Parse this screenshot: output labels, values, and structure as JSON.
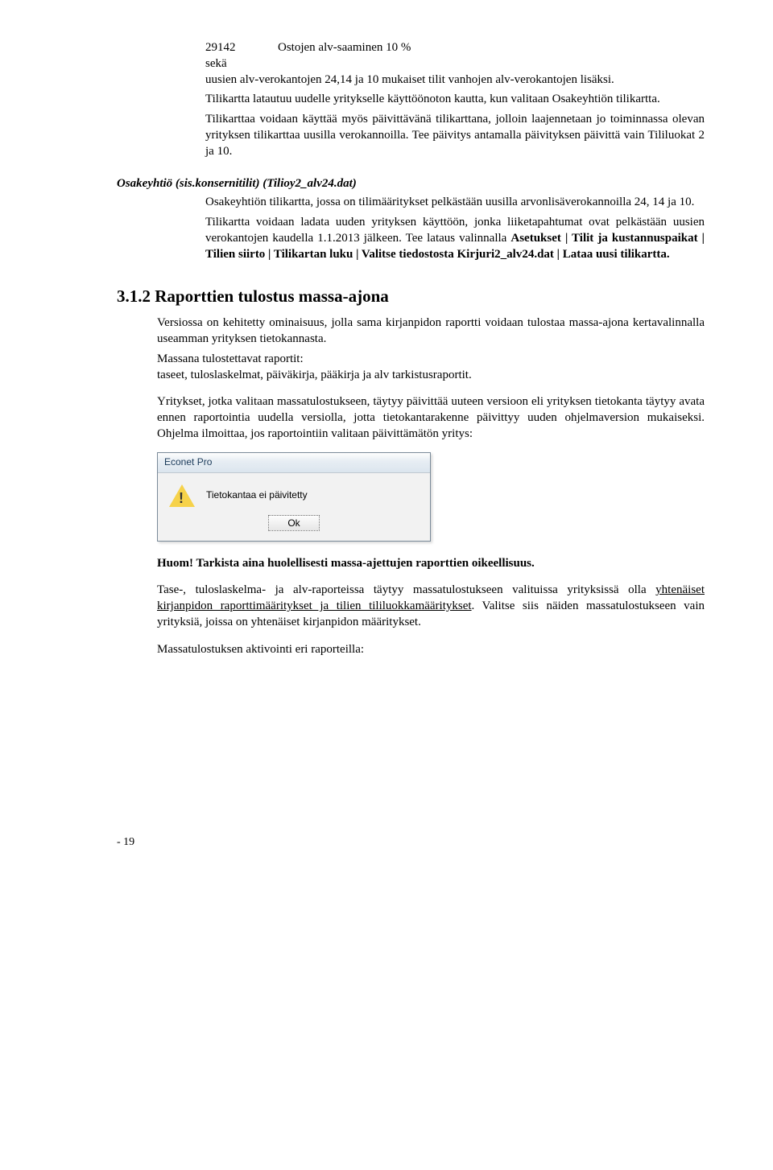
{
  "top": {
    "tili_code": "29142",
    "tili_name": "Ostojen alv-saaminen 10 %",
    "seka": "sekä",
    "p1": "uusien alv-verokantojen 24,14 ja 10 mukaiset tilit vanhojen alv-verokantojen lisäksi.",
    "p2": "Tilikartta latautuu uudelle yritykselle käyttöönoton kautta, kun valitaan Osakeyhtiön tilikartta.",
    "p3": "Tilikarttaa voidaan käyttää myös päivittävänä tilikarttana, jolloin laajennetaan jo toiminnassa olevan yrityksen tilikarttaa uusilla verokannoilla. Tee päivitys antamalla päivityksen päivittä vain Tililuokat 2 ja 10."
  },
  "osake": {
    "head": "Osakeyhtiö (sis.konsernitilit) (Tilioy2_alv24.dat)",
    "p1": "Osakeyhtiön tilikartta, jossa on tilimääritykset pelkästään uusilla arvonlisäverokannoilla 24, 14 ja 10.",
    "p2a": "Tilikartta voidaan ladata uuden yrityksen käyttöön, jonka liiketapahtumat ovat pelkästään uusien verokantojen kaudella 1.1.2013 jälkeen. Tee lataus valinnalla ",
    "p2b": "Asetukset | Tilit ja kustannuspaikat | Tilien siirto | Tilikartan luku | Valitse tiedostosta Kirjuri2_alv24.dat | Lataa uusi tilikartta."
  },
  "section": {
    "num": "3.1.2",
    "title": "Raporttien tulostus massa-ajona",
    "p1": "Versiossa on kehitetty ominaisuus, jolla sama kirjanpidon raportti voidaan tulostaa massa-ajona kertavalinnalla useamman yrityksen tietokannasta.",
    "p2": "Massana tulostettavat raportit:",
    "p3": "taseet, tuloslaskelmat, päiväkirja, pääkirja ja alv tarkistusraportit.",
    "p4": "Yritykset, jotka valitaan massatulostukseen, täytyy päivittää uuteen versioon eli yrityksen tietokanta täytyy avata ennen raportointia uudella versiolla, jotta tietokantarakenne päivittyy uuden ohjelmaversion mukaiseksi. Ohjelma ilmoittaa, jos raportointiin valitaan päivittämätön yritys:"
  },
  "dialog": {
    "title": "Econet Pro",
    "msg": "Tietokantaa ei päivitetty",
    "ok": "Ok"
  },
  "after": {
    "p1": "Huom! Tarkista aina huolellisesti massa-ajettujen raporttien oikeellisuus.",
    "p2a": "Tase-, tuloslaskelma- ja alv-raporteissa täytyy massatulostukseen valituissa yrityksissä olla ",
    "p2u": "yhtenäiset kirjanpidon raporttimääritykset ja tilien tililuokkamääritykset",
    "p2b": ". Valitse siis näiden massatulostukseen vain yrityksiä, joissa on yhtenäiset kirjanpidon määritykset.",
    "p3": "Massatulostuksen aktivointi eri raporteilla:"
  },
  "footer": "- 19"
}
